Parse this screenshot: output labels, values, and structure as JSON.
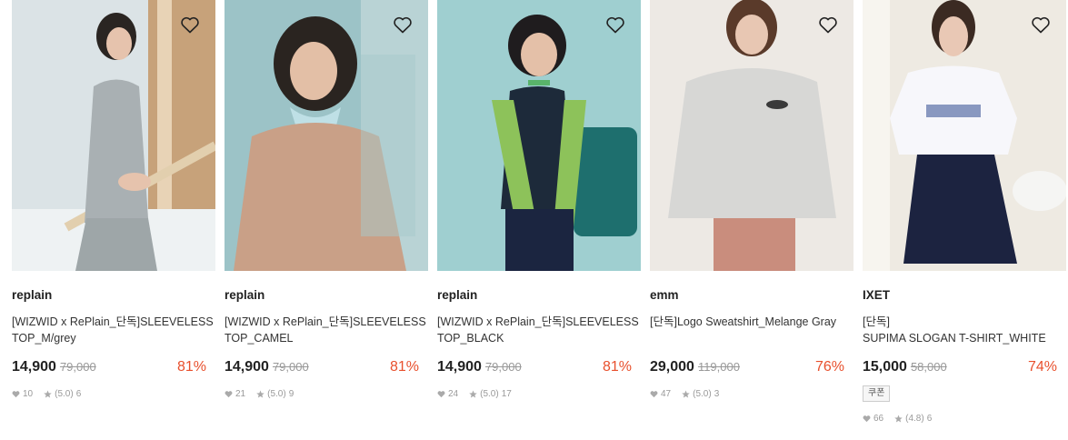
{
  "products": [
    {
      "brand": "replain",
      "title": "[WIZWID x RePlain_단독]SLEEVELESS TOP_M/grey",
      "price": "14,900",
      "original_price": "79,000",
      "discount": "81%",
      "likes": "10",
      "rating": "(5.0)",
      "reviews": "6",
      "coupon": ""
    },
    {
      "brand": "replain",
      "title": "[WIZWID x RePlain_단독]SLEEVELESS TOP_CAMEL",
      "price": "14,900",
      "original_price": "79,000",
      "discount": "81%",
      "likes": "21",
      "rating": "(5.0)",
      "reviews": "9",
      "coupon": ""
    },
    {
      "brand": "replain",
      "title": "[WIZWID x RePlain_단독]SLEEVELESS TOP_BLACK",
      "price": "14,900",
      "original_price": "79,000",
      "discount": "81%",
      "likes": "24",
      "rating": "(5.0)",
      "reviews": "17",
      "coupon": ""
    },
    {
      "brand": "emm",
      "title": "[단독]Logo Sweatshirt_Melange Gray",
      "price": "29,000",
      "original_price": "119,000",
      "discount": "76%",
      "likes": "47",
      "rating": "(5.0)",
      "reviews": "3",
      "coupon": ""
    },
    {
      "brand": "IXET",
      "title_line1": "[단독]",
      "title_line2": "SUPIMA SLOGAN T-SHIRT_WHITE",
      "price": "15,000",
      "original_price": "58,000",
      "discount": "74%",
      "likes": "66",
      "rating": "(4.8)",
      "reviews": "6",
      "coupon": "쿠폰"
    }
  ],
  "icons": {
    "wishlist": "heart-outline-icon",
    "likes": "heart-icon",
    "rating": "star-icon"
  },
  "colors": {
    "discount": "#e8502d",
    "meta": "#999999"
  }
}
